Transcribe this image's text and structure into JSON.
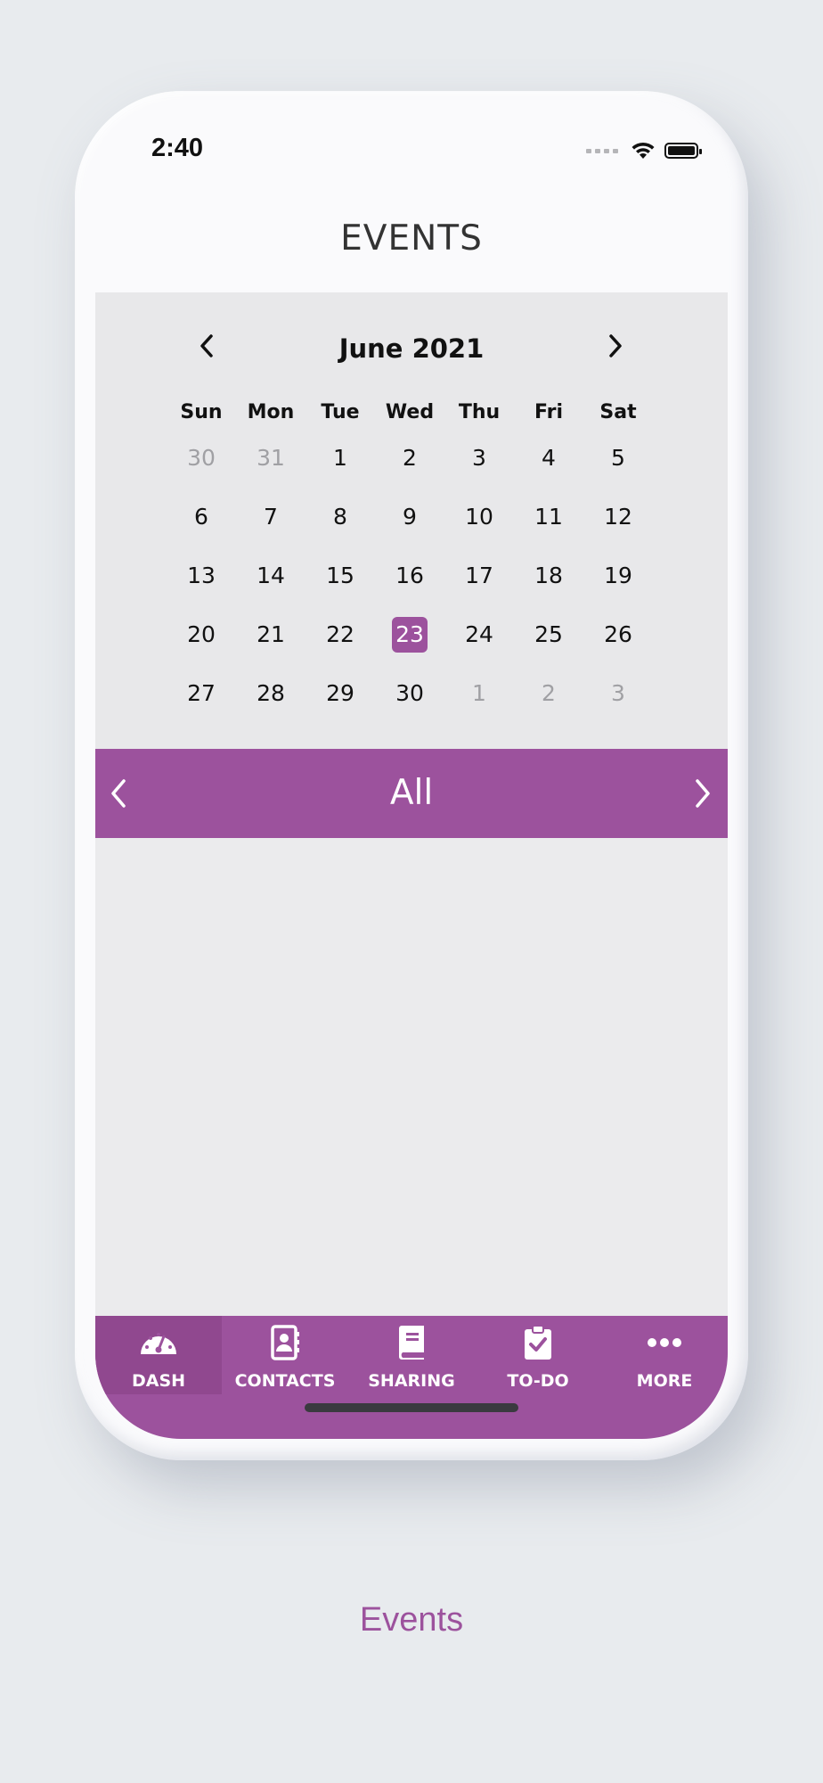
{
  "status_bar": {
    "time": "2:40"
  },
  "header": {
    "title": "EVENTS"
  },
  "calendar": {
    "month_label": "June 2021",
    "weekdays": [
      "Sun",
      "Mon",
      "Tue",
      "Wed",
      "Thu",
      "Fri",
      "Sat"
    ],
    "weeks": [
      [
        {
          "d": "30",
          "muted": true
        },
        {
          "d": "31",
          "muted": true
        },
        {
          "d": "1"
        },
        {
          "d": "2"
        },
        {
          "d": "3"
        },
        {
          "d": "4"
        },
        {
          "d": "5"
        }
      ],
      [
        {
          "d": "6"
        },
        {
          "d": "7"
        },
        {
          "d": "8"
        },
        {
          "d": "9"
        },
        {
          "d": "10"
        },
        {
          "d": "11"
        },
        {
          "d": "12"
        }
      ],
      [
        {
          "d": "13"
        },
        {
          "d": "14"
        },
        {
          "d": "15"
        },
        {
          "d": "16"
        },
        {
          "d": "17"
        },
        {
          "d": "18"
        },
        {
          "d": "19"
        }
      ],
      [
        {
          "d": "20"
        },
        {
          "d": "21"
        },
        {
          "d": "22"
        },
        {
          "d": "23",
          "selected": true
        },
        {
          "d": "24"
        },
        {
          "d": "25"
        },
        {
          "d": "26"
        }
      ],
      [
        {
          "d": "27"
        },
        {
          "d": "28"
        },
        {
          "d": "29"
        },
        {
          "d": "30"
        },
        {
          "d": "1",
          "muted": true
        },
        {
          "d": "2",
          "muted": true
        },
        {
          "d": "3",
          "muted": true
        }
      ]
    ],
    "selected_day": "23"
  },
  "filter": {
    "label": "All"
  },
  "tabbar": {
    "items": [
      {
        "label": "DASH",
        "icon": "dashboard-gauge-icon",
        "active": true
      },
      {
        "label": "CONTACTS",
        "icon": "contacts-book-icon"
      },
      {
        "label": "SHARING",
        "icon": "book-icon"
      },
      {
        "label": "TO-DO",
        "icon": "clipboard-check-icon"
      },
      {
        "label": "MORE",
        "icon": "more-dots-icon"
      }
    ]
  },
  "caption": "Events",
  "colors": {
    "accent": "#9c529d",
    "accent_active": "#90488f",
    "background": "#e8ebee",
    "calendar_bg": "#e8e8ea"
  }
}
